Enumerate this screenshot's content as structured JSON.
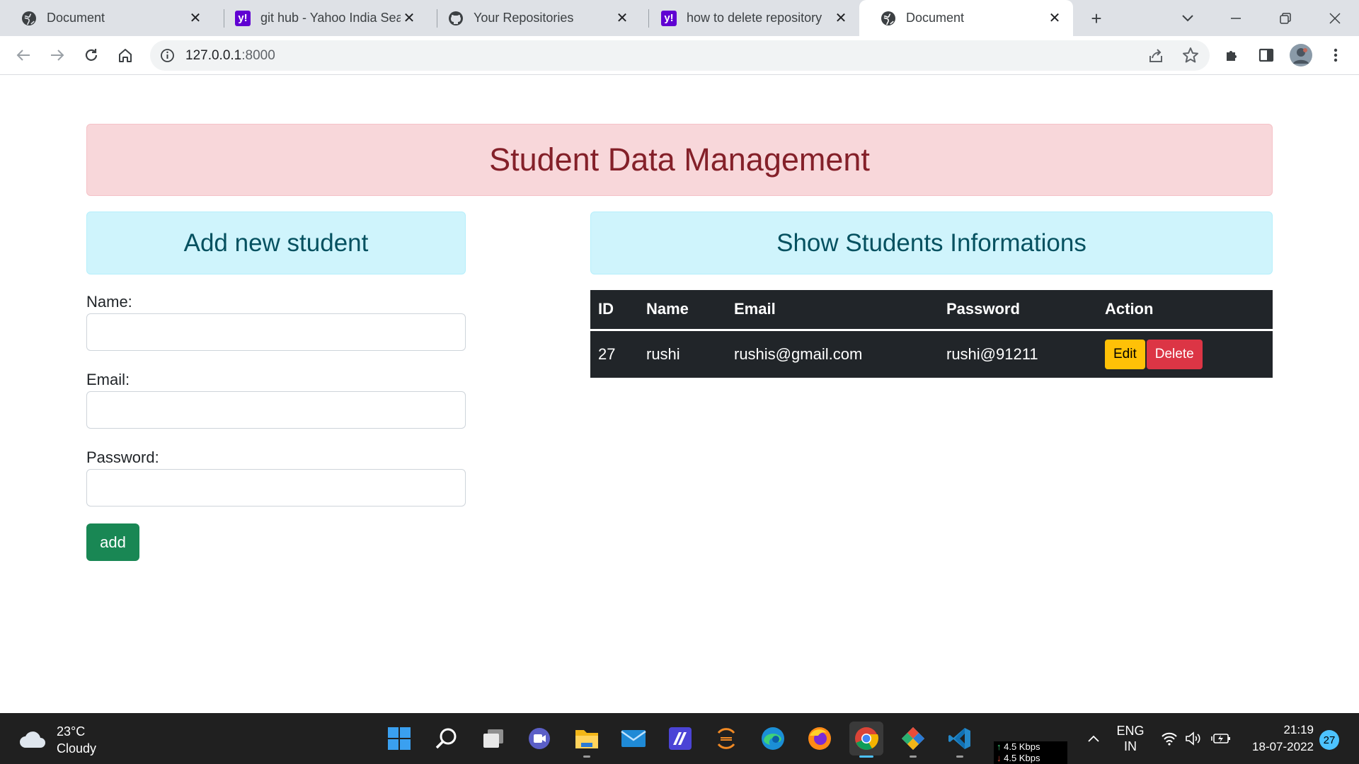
{
  "browser": {
    "tabs": [
      {
        "title": "Document",
        "icon": "globe-icon"
      },
      {
        "title": "git hub - Yahoo India Sear",
        "icon": "yahoo-icon"
      },
      {
        "title": "Your Repositories",
        "icon": "github-icon"
      },
      {
        "title": "how to delete repository",
        "icon": "yahoo-icon"
      },
      {
        "title": "Document",
        "icon": "globe-icon"
      }
    ],
    "active_tab": 4,
    "new_tab_glyph": "+",
    "url_host": "127.0.0.1",
    "url_port": ":8000",
    "yahoo_glyph": "y!"
  },
  "page": {
    "title": "Student Data Management",
    "add_heading": "Add new student",
    "show_heading": "Show Students Informations",
    "form": {
      "name_label": "Name:",
      "email_label": "Email:",
      "password_label": "Password:",
      "name_value": "",
      "email_value": "",
      "password_value": "",
      "add_label": "add"
    },
    "table": {
      "headers": [
        "ID",
        "Name",
        "Email",
        "Password",
        "Action"
      ],
      "rows": [
        {
          "id": "27",
          "name": "rushi",
          "email": "rushis@gmail.com",
          "password": "rushi@91211",
          "edit_label": "Edit",
          "delete_label": "Delete"
        }
      ]
    }
  },
  "taskbar": {
    "weather_temp": "23°C",
    "weather_desc": "Cloudy",
    "net_up": "4.5 Kbps",
    "net_down": "4.5 Kbps",
    "lang_line1": "ENG",
    "lang_line2": "IN",
    "time": "21:19",
    "date": "18-07-2022",
    "notification_count": "27"
  },
  "colors": {
    "danger_bg": "#f8d7da",
    "danger_text": "#842029",
    "info_bg": "#cff4fc",
    "info_text": "#055160",
    "success": "#198754",
    "warning": "#ffc107",
    "danger": "#dc3545",
    "table_dark": "#212529"
  }
}
